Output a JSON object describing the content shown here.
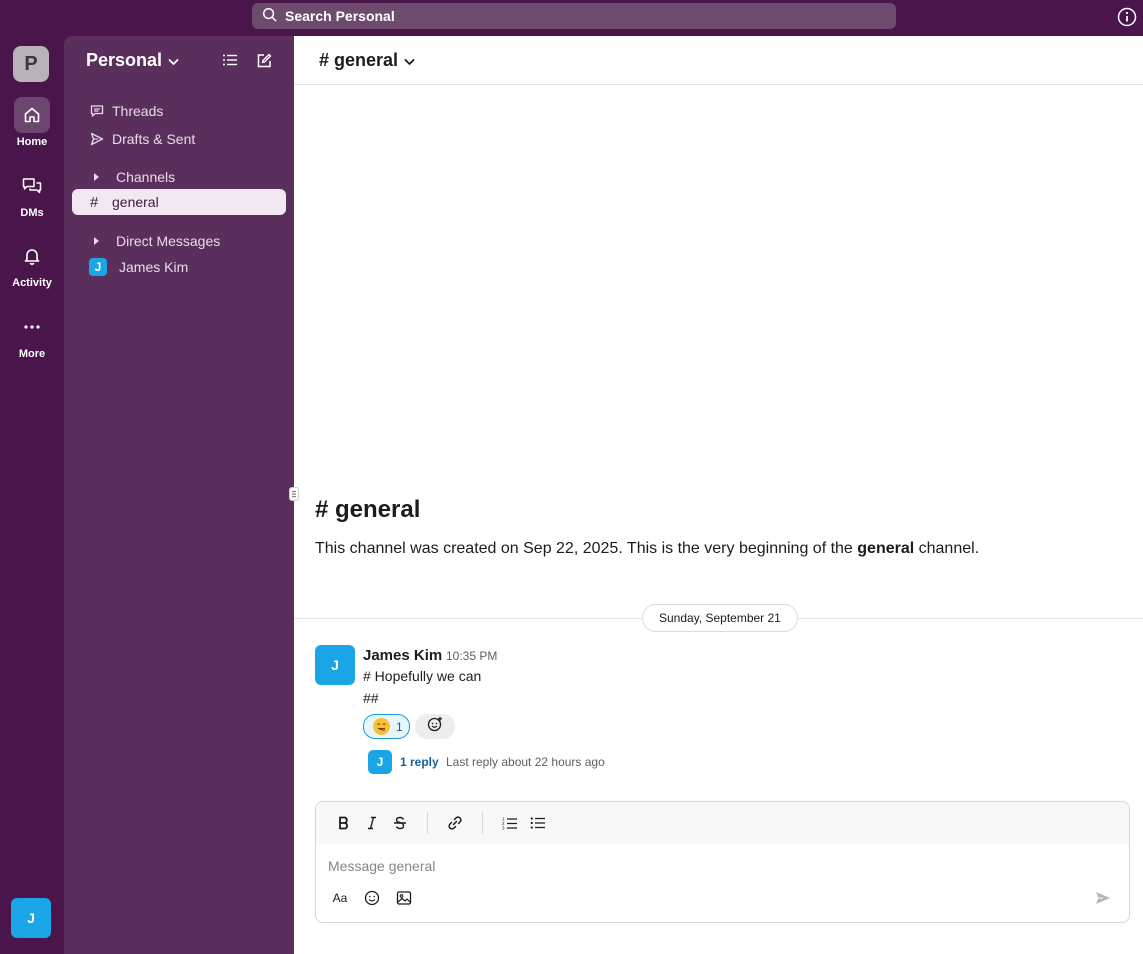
{
  "search": {
    "placeholder": "Search Personal"
  },
  "workspace": {
    "initial": "P",
    "name": "Personal"
  },
  "rail": {
    "items": [
      {
        "label": "Home",
        "icon": "home-icon"
      },
      {
        "label": "DMs",
        "icon": "messages-icon"
      },
      {
        "label": "Activity",
        "icon": "bell-icon"
      },
      {
        "label": "More",
        "icon": "more-icon"
      }
    ],
    "user_initial": "J"
  },
  "sidebar": {
    "threads": "Threads",
    "drafts": "Drafts & Sent",
    "channels_section": "Channels",
    "channels": [
      {
        "name": "general"
      }
    ],
    "dm_section": "Direct Messages",
    "dms": [
      {
        "initial": "J",
        "name": "James Kim"
      }
    ]
  },
  "channel": {
    "header": "# general",
    "intro_title": "# general",
    "intro_prefix": "This channel was created on Sep 22, 2025. This is the very beginning of the ",
    "intro_bold": "general",
    "intro_suffix": " channel."
  },
  "date_divider": "Sunday, September 21",
  "message": {
    "avatar_initial": "J",
    "author": "James Kim",
    "time": "10:35 PM",
    "line1": "# Hopefully we can",
    "line2": "##",
    "reaction_count": "1",
    "reply_avatar_initial": "J",
    "reply_count": "1 reply",
    "reply_last": "Last reply about 22 hours ago"
  },
  "composer": {
    "placeholder": "Message general",
    "format_aa": "Aa"
  },
  "colors": {
    "rail_bg": "#4a154b",
    "sidebar_bg": "#5b2f5c",
    "avatar_blue": "#1aa5e6",
    "link_blue": "#1264a3"
  }
}
